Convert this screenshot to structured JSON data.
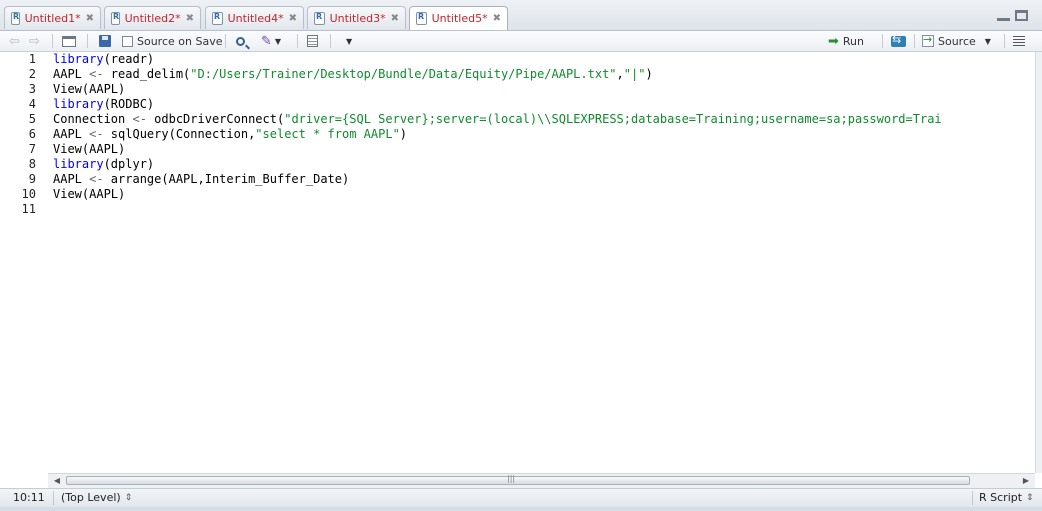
{
  "tabs": [
    {
      "label": "Untitled1*",
      "active": false
    },
    {
      "label": "Untitled2*",
      "active": false
    },
    {
      "label": "Untitled4*",
      "active": false
    },
    {
      "label": "Untitled3*",
      "active": false
    },
    {
      "label": "Untitled5*",
      "active": true
    }
  ],
  "toolbar": {
    "source_on_save": "Source on Save",
    "run": "Run",
    "source": "Source"
  },
  "editor": {
    "line_numbers": [
      "1",
      "2",
      "3",
      "4",
      "5",
      "6",
      "7",
      "8",
      "9",
      "10",
      "11"
    ],
    "lines": [
      [
        {
          "t": "library",
          "c": "kw"
        },
        {
          "t": "(readr)",
          "c": ""
        }
      ],
      [
        {
          "t": "AAPL ",
          "c": ""
        },
        {
          "t": "<-",
          "c": "op"
        },
        {
          "t": " read_delim(",
          "c": ""
        },
        {
          "t": "\"D:/Users/Trainer/Desktop/Bundle/Data/Equity/Pipe/AAPL.txt\"",
          "c": "str"
        },
        {
          "t": ",",
          "c": ""
        },
        {
          "t": "\"|\"",
          "c": "str"
        },
        {
          "t": ")",
          "c": ""
        }
      ],
      [
        {
          "t": "View(AAPL)",
          "c": ""
        }
      ],
      [
        {
          "t": "library",
          "c": "kw"
        },
        {
          "t": "(RODBC)",
          "c": ""
        }
      ],
      [
        {
          "t": "Connection ",
          "c": ""
        },
        {
          "t": "<-",
          "c": "op"
        },
        {
          "t": " odbcDriverConnect(",
          "c": ""
        },
        {
          "t": "\"driver={SQL Server};server=(local)\\\\SQLEXPRESS;database=Training;username=sa;password=Trai",
          "c": "str"
        }
      ],
      [
        {
          "t": "AAPL ",
          "c": ""
        },
        {
          "t": "<-",
          "c": "op"
        },
        {
          "t": " sqlQuery(Connection,",
          "c": ""
        },
        {
          "t": "\"select * from AAPL\"",
          "c": "str"
        },
        {
          "t": ")",
          "c": ""
        }
      ],
      [
        {
          "t": "View(AAPL)",
          "c": ""
        }
      ],
      [
        {
          "t": "library",
          "c": "kw"
        },
        {
          "t": "(dplyr)",
          "c": ""
        }
      ],
      [
        {
          "t": "AAPL ",
          "c": ""
        },
        {
          "t": "<-",
          "c": "op"
        },
        {
          "t": " arrange(AAPL,Interim_Buffer_Date)",
          "c": ""
        }
      ],
      [
        {
          "t": "View(AAPL)",
          "c": ""
        }
      ],
      []
    ]
  },
  "status": {
    "cursor": "10:11",
    "scope": "(Top Level)",
    "filetype": "R Script"
  },
  "colors": {
    "tab_label": "#c0272d",
    "keyword": "#0000ff",
    "string": "#0f8b2d"
  }
}
